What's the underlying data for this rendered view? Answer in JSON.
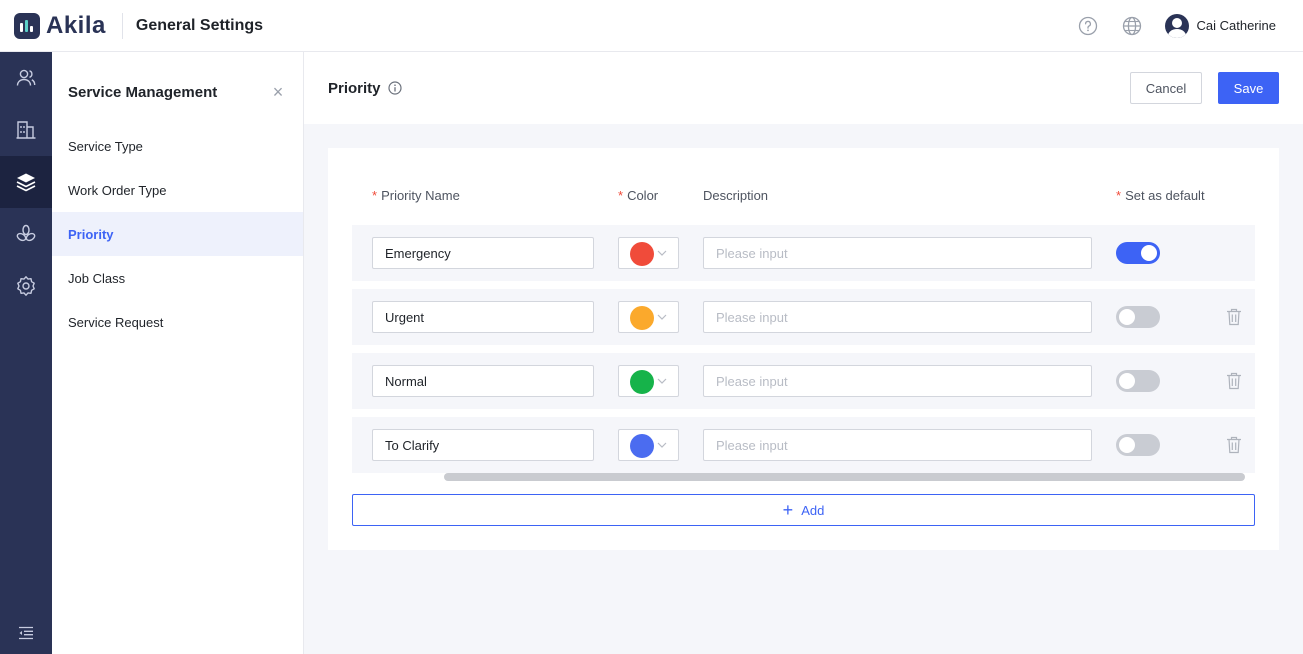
{
  "header": {
    "logo_text": "Akila",
    "title": "General Settings",
    "help_icon": "help-circle-icon",
    "language_icon": "globe-icon",
    "user_name": "Cai Catherine"
  },
  "rail": {
    "items": [
      {
        "icon": "users-icon",
        "active": false
      },
      {
        "icon": "building-icon",
        "active": false
      },
      {
        "icon": "layers-icon",
        "active": true
      },
      {
        "icon": "flower-icon",
        "active": false
      },
      {
        "icon": "gear-icon",
        "active": false
      }
    ],
    "bottom_icon": "collapse-menu-icon"
  },
  "subnav": {
    "title": "Service Management",
    "close_label": "×",
    "items": [
      {
        "label": "Service Type",
        "active": false
      },
      {
        "label": "Work Order Type",
        "active": false
      },
      {
        "label": "Priority",
        "active": true
      },
      {
        "label": "Job Class",
        "active": false
      },
      {
        "label": "Service Request",
        "active": false
      }
    ]
  },
  "main": {
    "title": "Priority",
    "cancel_label": "Cancel",
    "save_label": "Save",
    "columns": {
      "required_mark": "*",
      "priority_name": "Priority Name",
      "color": "Color",
      "description": "Description",
      "set_as_default": "Set as default"
    },
    "rows": [
      {
        "name": "Emergency",
        "color": "#f04b3a",
        "description_placeholder": "Please input",
        "is_default": true,
        "deletable": false
      },
      {
        "name": "Urgent",
        "color": "#fba92c",
        "description_placeholder": "Please input",
        "is_default": false,
        "deletable": true
      },
      {
        "name": "Normal",
        "color": "#16b34a",
        "description_placeholder": "Please input",
        "is_default": false,
        "deletable": true
      },
      {
        "name": "To Clarify",
        "color": "#4b6cf0",
        "description_placeholder": "Please input",
        "is_default": false,
        "deletable": true
      }
    ],
    "add_label": "Add",
    "add_symbol": "+"
  }
}
